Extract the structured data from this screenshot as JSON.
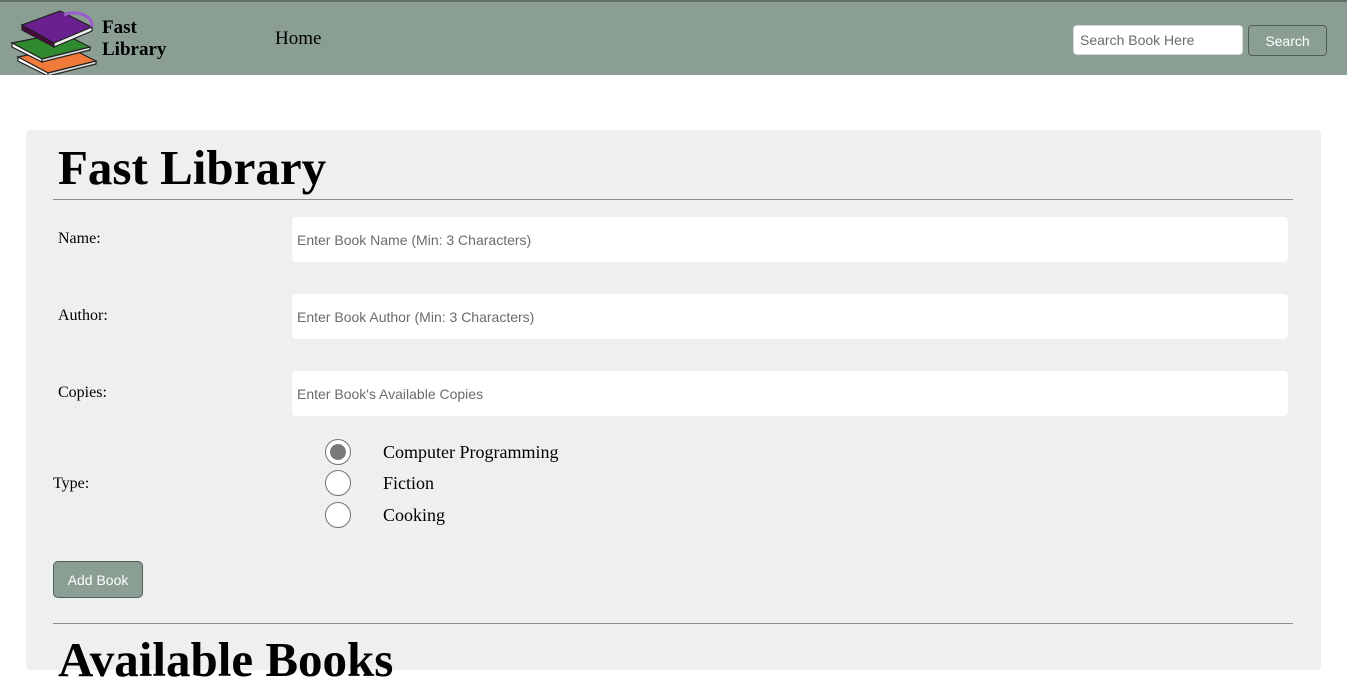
{
  "navbar": {
    "brand_line1": "Fast",
    "brand_line2": "Library",
    "logo_icon": "books-stack-icon",
    "home_label": "Home",
    "search_placeholder": "Search Book Here",
    "search_button_label": "Search",
    "background_color": "#8a9e94"
  },
  "form": {
    "title": "Fast Library",
    "name_label": "Name:",
    "name_placeholder": "Enter Book Name (Min: 3 Characters)",
    "author_label": "Author:",
    "author_placeholder": "Enter Book Author (Min: 3 Characters)",
    "copies_label": "Copies:",
    "copies_placeholder": "Enter Book's Available Copies",
    "type_label": "Type:",
    "type_options": [
      "Computer Programming",
      "Fiction",
      "Cooking"
    ],
    "selected_type": "Computer Programming",
    "add_button_label": "Add Book"
  },
  "books_section": {
    "title": "Available Books"
  }
}
